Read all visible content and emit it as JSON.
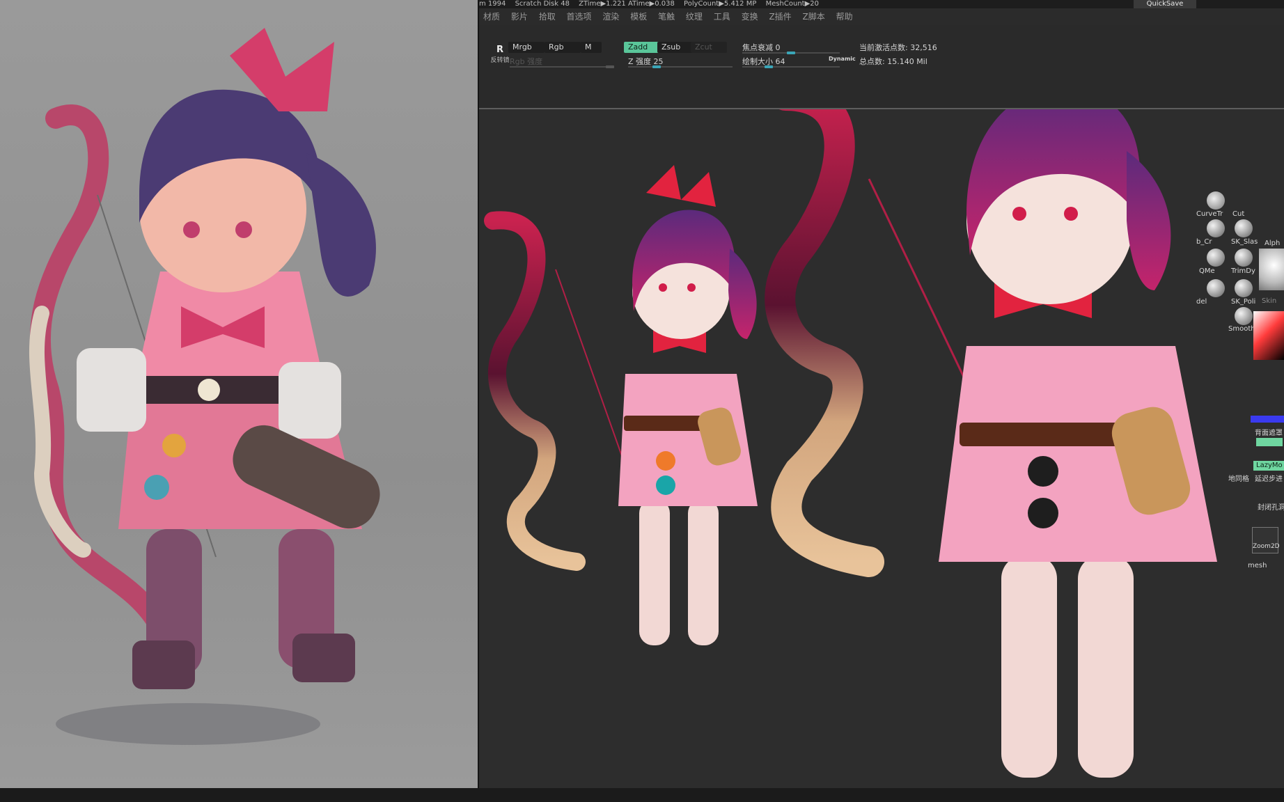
{
  "statusbar": {
    "items": [
      "m 1994",
      "Scratch Disk 48",
      "ZTime▶1.221 ATime▶0.038",
      "PolyCount▶5.412 MP",
      "MeshCount▶20"
    ]
  },
  "quicksave": "QuickSave",
  "menu": [
    "材质",
    "影片",
    "拾取",
    "首选项",
    "渲染",
    "模板",
    "笔触",
    "纹理",
    "工具",
    "变换",
    "Z插件",
    "Z脚本",
    "帮助"
  ],
  "toolbar": {
    "rotate_icon": "R",
    "rotate_label": "反转镜",
    "mrgb": "Mrgb",
    "rgb": "Rgb",
    "m": "M",
    "rgb_strength": "Rgb 强度",
    "zadd": "Zadd",
    "zsub": "Zsub",
    "zcut": "Zcut",
    "z_strength_label": "Z 强度",
    "z_strength_value": "25",
    "focal_label": "焦点衰减",
    "focal_value": "0",
    "draw_size_label": "绘制大小",
    "draw_size_value": "64",
    "dynamic": "Dynamic",
    "active_points": "当前激活点数: 32,516",
    "total_points": "总点数: 15.140 Mil",
    "z_strength_fraction": 0.25,
    "focal_fraction": 0.5,
    "draw_size_fraction": 0.25
  },
  "right_tray": {
    "items": [
      "CurveTr",
      "Cut",
      "b_Cr",
      "SK_Slas",
      "QMe",
      "TrimDy",
      "del",
      "SK_Poli",
      "Smooth",
      "Alph",
      "Skin",
      "背面遮罩",
      "LazyMo",
      "延迟步进",
      "地同格",
      "封闭孔洞",
      "Zoom2D",
      "mesh"
    ]
  },
  "colors": {
    "accent_green": "#5ac69a",
    "slider_teal": "#3aa6b8",
    "viewport_bg": "#2d2d2d"
  }
}
